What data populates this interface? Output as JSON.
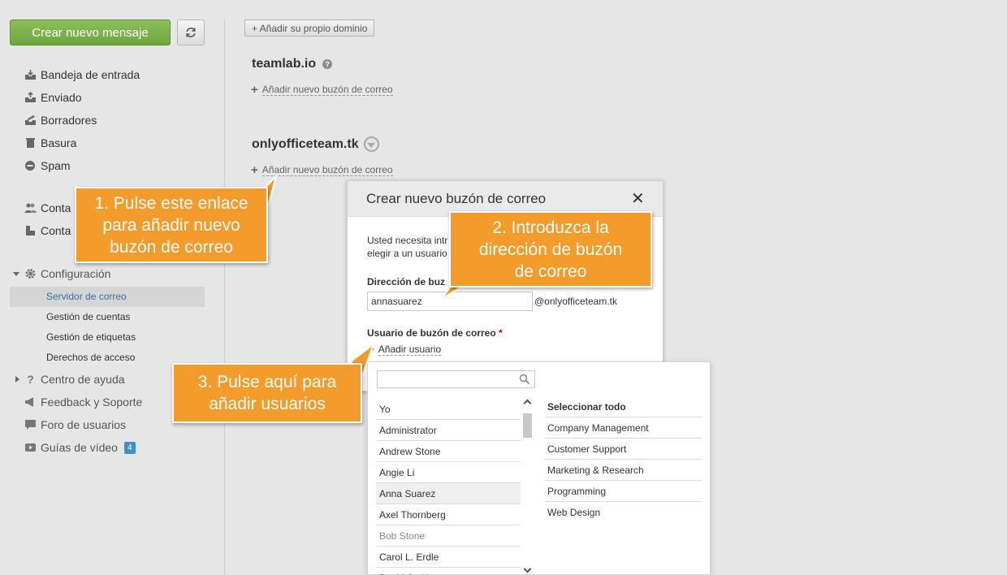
{
  "sidebar": {
    "create_button": "Crear nuevo mensaje",
    "folders": [
      {
        "label": "Bandeja de entrada",
        "icon": "inbox-icon"
      },
      {
        "label": "Enviado",
        "icon": "sent-icon"
      },
      {
        "label": "Borradores",
        "icon": "drafts-icon"
      },
      {
        "label": "Basura",
        "icon": "trash-icon"
      },
      {
        "label": "Spam",
        "icon": "spam-icon"
      }
    ],
    "contacts": [
      {
        "label": "Conta",
        "icon": "people-icon"
      },
      {
        "label": "Conta",
        "icon": "contacts-icon"
      }
    ],
    "config": {
      "label": "Configuración",
      "items": [
        "Servidor de correo",
        "Gestión de cuentas",
        "Gestión de etiquetas",
        "Derechos de acceso"
      ]
    },
    "help": "Centro de ayuda",
    "feedback": "Feedback y Soporte",
    "forum": "Foro de usuarios",
    "videos": "Guías de vídeo",
    "videos_badge": "4"
  },
  "main": {
    "add_domain": "+ Añadir su propio dominio",
    "domains": [
      {
        "name": "teamlab.io",
        "add_mailbox": "Añadir nuevo buzón de correo"
      },
      {
        "name": "onlyofficeteam.tk",
        "add_mailbox": "Añadir nuevo buzón de correo"
      }
    ]
  },
  "dialog": {
    "title": "Crear nuevo buzón de correo",
    "close": "✕",
    "text_line1": "Usted necesita intr",
    "text_line2": "elegir a un usuario",
    "address_label": "Dirección de buz",
    "address_value": "annasuarez",
    "address_domain": "@onlyofficeteam.tk",
    "user_label": "Usuario de buzón de correo",
    "required_mark": "*",
    "add_user": "Añadir usuario"
  },
  "picker": {
    "search_value": "",
    "users": [
      "Yo",
      "Administrator",
      "Andrew Stone",
      "Angie Li",
      "Anna Suarez",
      "Axel Thornberg",
      "Bob Stone",
      "Carol L. Erdle",
      "David Smith"
    ],
    "select_all": "Seleccionar todo",
    "groups": [
      "Company Management",
      "Customer Support",
      "Marketing & Research",
      "Programming",
      "Web Design"
    ]
  },
  "callouts": {
    "c1": "1. Pulse este enlace\npara añadir nuevo\nbuzón de correo",
    "c2": "2. Introduzca la\ndirección de buzón\nde correo",
    "c3": "3. Pulse aquí para\nañadir usuarios"
  },
  "colors": {
    "create_button": "#7cb44a",
    "callout": "#f39c2b",
    "badge": "#3d8fc9",
    "background": "#e6e6e6"
  }
}
